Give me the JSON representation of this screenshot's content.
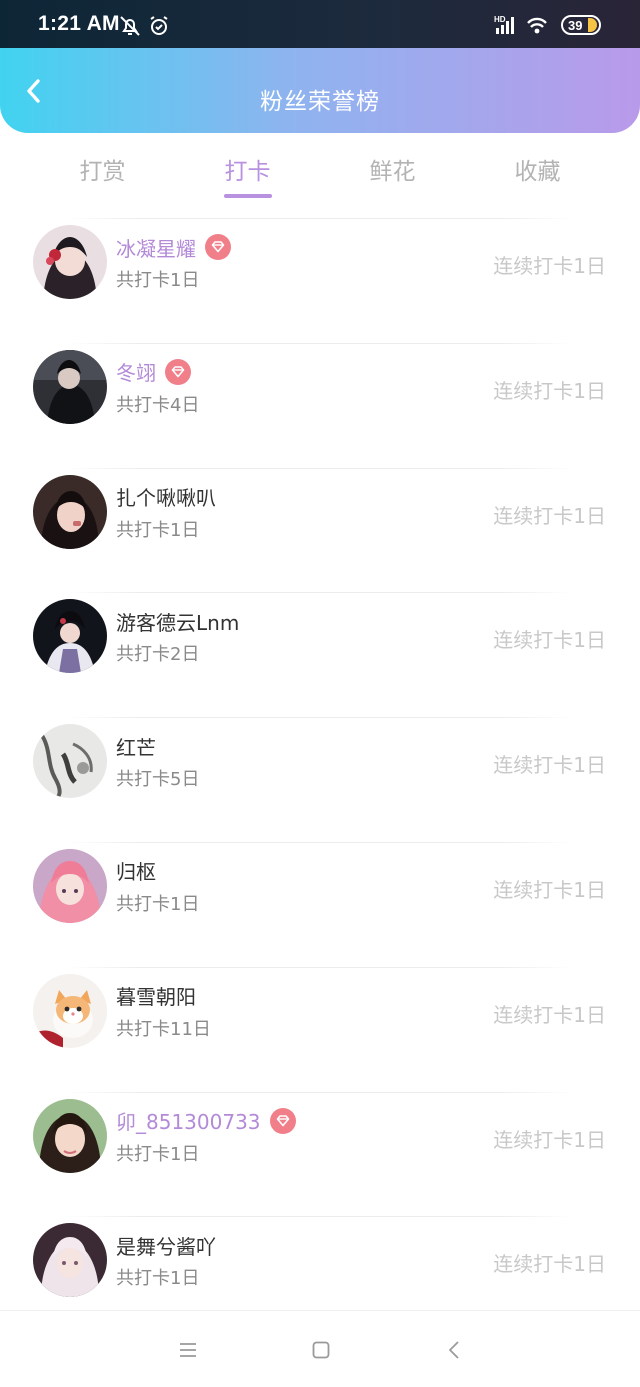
{
  "status_bar": {
    "time": "1:21 AM",
    "icons_left": [
      "bell-off-icon",
      "alarm-icon"
    ],
    "icons_right": [
      "hd-signal-icon",
      "wifi-icon",
      "battery-icon"
    ],
    "battery_level": "39"
  },
  "header": {
    "title": "粉丝荣誉榜",
    "back_icon": "chevron-left-icon",
    "gradient_colors": [
      "#41d3f0",
      "#b99aea"
    ]
  },
  "tabs": [
    {
      "label": "打赏",
      "active": false
    },
    {
      "label": "打卡",
      "active": true
    },
    {
      "label": "鲜花",
      "active": false
    },
    {
      "label": "收藏",
      "active": false
    }
  ],
  "colors": {
    "accent": "#b891e0",
    "vip_name": "#b38ad8",
    "badge": "#f07f8a"
  },
  "fans": [
    {
      "name": "冰凝星耀",
      "vip": true,
      "total": "共打卡1日",
      "streak": "连续打卡1日"
    },
    {
      "name": "冬翊",
      "vip": true,
      "total": "共打卡4日",
      "streak": "连续打卡1日"
    },
    {
      "name": "扎个啾啾叭",
      "vip": false,
      "total": "共打卡1日",
      "streak": "连续打卡1日"
    },
    {
      "name": "游客德云Lnm",
      "vip": false,
      "total": "共打卡2日",
      "streak": "连续打卡1日"
    },
    {
      "name": "红芒",
      "vip": false,
      "total": "共打卡5日",
      "streak": "连续打卡1日"
    },
    {
      "name": "归枢",
      "vip": false,
      "total": "共打卡1日",
      "streak": "连续打卡1日"
    },
    {
      "name": "暮雪朝阳",
      "vip": false,
      "total": "共打卡11日",
      "streak": "连续打卡1日"
    },
    {
      "name": "卯_851300733",
      "vip": true,
      "total": "共打卡1日",
      "streak": "连续打卡1日"
    },
    {
      "name": "是舞兮酱吖",
      "vip": false,
      "total": "共打卡1日",
      "streak": "连续打卡1日"
    }
  ],
  "system_nav": {
    "icons": [
      "menu-icon",
      "home-square-icon",
      "back-triangle-icon"
    ]
  }
}
